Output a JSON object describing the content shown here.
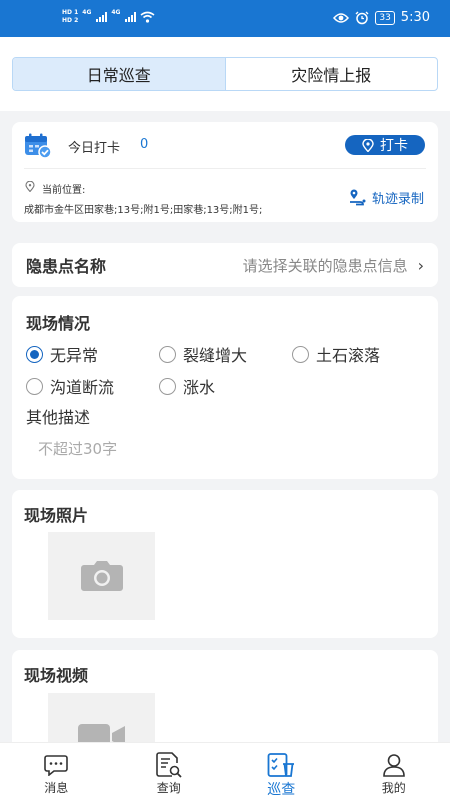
{
  "status_bar": {
    "sim1": "HD 1",
    "sim2": "HD 2",
    "net1": "4G",
    "net2": "4G",
    "battery": "33",
    "time": "5:30",
    "icons": [
      "signal-icon",
      "wifi-icon",
      "eye-icon",
      "alarm-icon",
      "battery-icon"
    ]
  },
  "segment": {
    "tabs": [
      {
        "label": "日常巡查",
        "active": true
      },
      {
        "label": "灾险情上报",
        "active": false
      }
    ]
  },
  "checkin": {
    "label": "今日打卡",
    "count": "0",
    "button": "打卡",
    "location_label": "当前位置:",
    "address": "成都市金牛区田家巷;13号;附1号;田家巷;13号;附1号;",
    "track_button": "轨迹录制"
  },
  "hazard": {
    "title": "隐患点名称",
    "placeholder": "请选择关联的隐患点信息"
  },
  "situation": {
    "title": "现场情况",
    "options": [
      {
        "label": "无异常",
        "checked": true
      },
      {
        "label": "裂缝增大",
        "checked": false
      },
      {
        "label": "土石滚落",
        "checked": false
      },
      {
        "label": "沟道断流",
        "checked": false
      },
      {
        "label": "涨水",
        "checked": false
      }
    ],
    "other_title": "其他描述",
    "other_placeholder": "不超过30字"
  },
  "photos": {
    "title": "现场照片"
  },
  "videos": {
    "title": "现场视频"
  },
  "tabbar": {
    "tabs": [
      {
        "label": "消息",
        "icon": "message-icon",
        "active": false
      },
      {
        "label": "查询",
        "icon": "query-icon",
        "active": false
      },
      {
        "label": "巡查",
        "icon": "inspection-icon",
        "active": true
      },
      {
        "label": "我的",
        "icon": "profile-icon",
        "active": false
      }
    ]
  },
  "colors": {
    "primary": "#1976d2",
    "button": "#1565c0",
    "segment_active": "#dcebfb",
    "background": "#f2f3f5"
  }
}
